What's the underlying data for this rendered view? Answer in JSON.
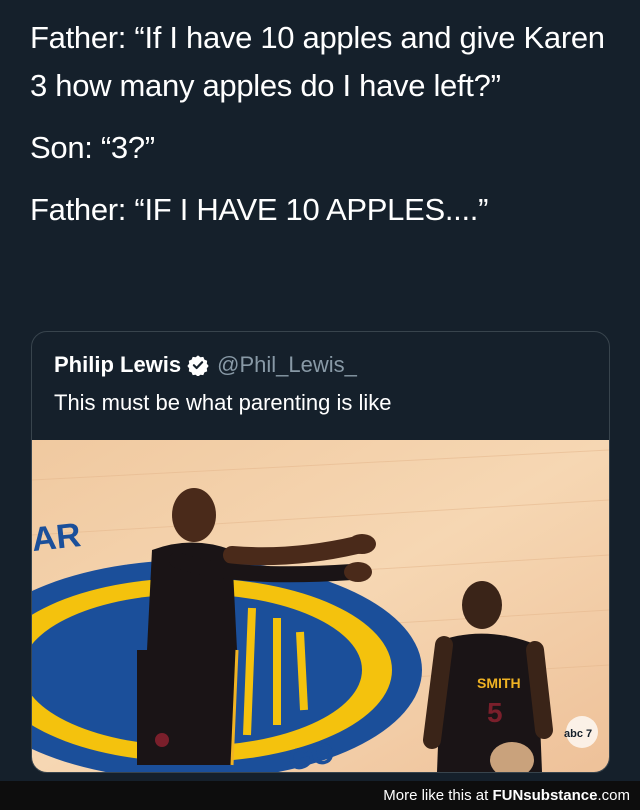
{
  "tweet": {
    "lines": [
      "Father: “If I have 10 apples and give Karen 3 how many apples do I have left?”",
      "Son: “3?”",
      "Father: “IF I HAVE 10 APPLES....”"
    ]
  },
  "quote": {
    "name": "Philip Lewis",
    "handle": "@Phil_Lewis_",
    "text": "This must be what parenting is like",
    "verified_color": "#ffffff"
  },
  "photo": {
    "jersey_name": "SMITH",
    "jersey_number": "5",
    "court_letters_bottom": "GO",
    "channel_logo": "abc 7"
  },
  "footer": {
    "prefix": "More like this at ",
    "brand": "FUNsubstance",
    "suffix": ".com"
  }
}
